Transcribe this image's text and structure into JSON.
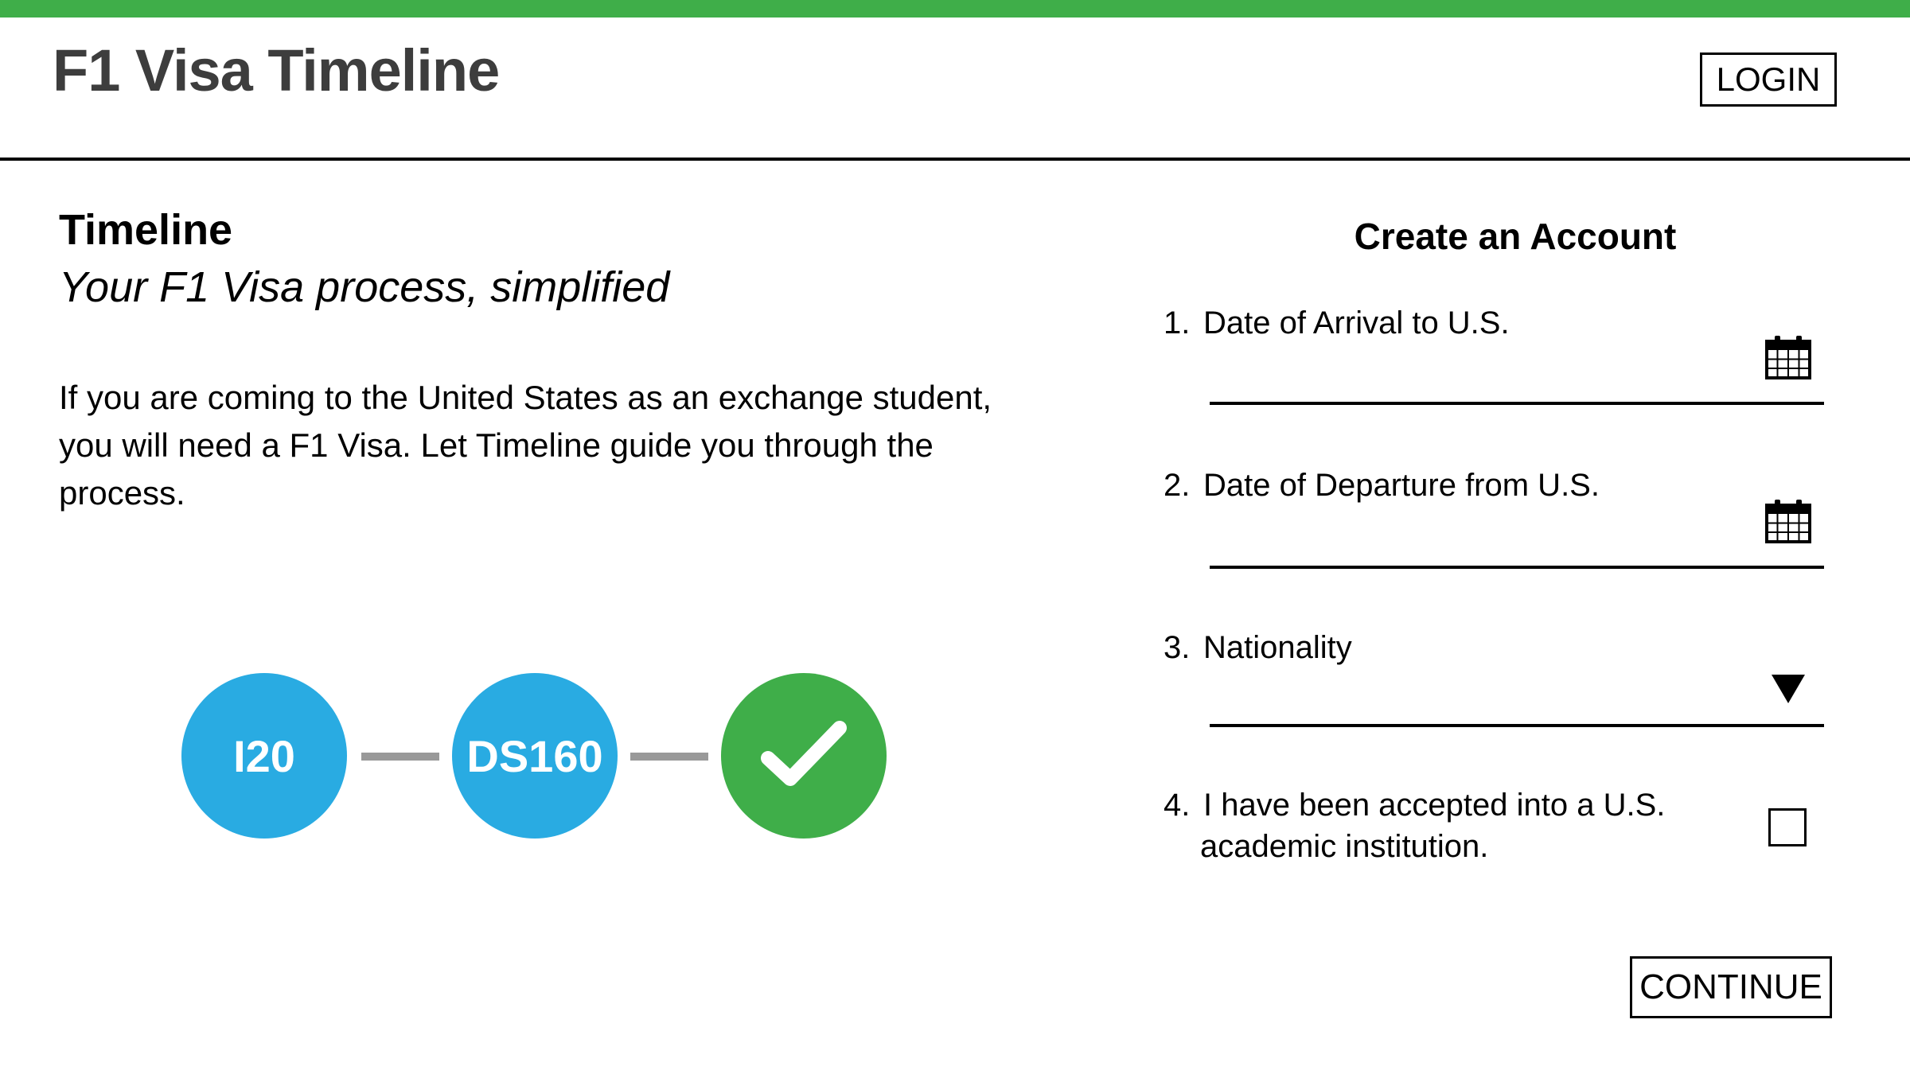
{
  "header": {
    "title": "F1 Visa Timeline",
    "login_label": "LOGIN"
  },
  "intro": {
    "title": "Timeline",
    "subtitle": "Your F1 Visa process, simplified",
    "body": "If you are coming to the United States as an exchange student, you will need a F1 Visa. Let Timeline guide you through the process."
  },
  "steps": [
    {
      "label": "I20",
      "status": "pending",
      "color": "#29abe2"
    },
    {
      "label": "DS160",
      "status": "pending",
      "color": "#29abe2"
    },
    {
      "label": "",
      "status": "complete",
      "icon": "checkmark-icon",
      "color": "#3fae49"
    }
  ],
  "form": {
    "title": "Create an Account",
    "fields": [
      {
        "number": "1.",
        "label": "Date of Arrival to U.S.",
        "type": "date",
        "value": "",
        "icon": "calendar-icon"
      },
      {
        "number": "2.",
        "label": "Date of Departure from U.S.",
        "type": "date",
        "value": "",
        "icon": "calendar-icon"
      },
      {
        "number": "3.",
        "label": "Nationality",
        "type": "select",
        "value": "",
        "icon": "dropdown-triangle-icon"
      },
      {
        "number": "4.",
        "label_line1": "I have been accepted into a U.S.",
        "label_line2": "academic institution.",
        "type": "checkbox",
        "checked": false
      }
    ],
    "continue_label": "CONTINUE"
  },
  "colors": {
    "accent": "#3fae49",
    "step_blue": "#29abe2",
    "title_gray": "#3d3d3d",
    "connector": "#999999"
  }
}
